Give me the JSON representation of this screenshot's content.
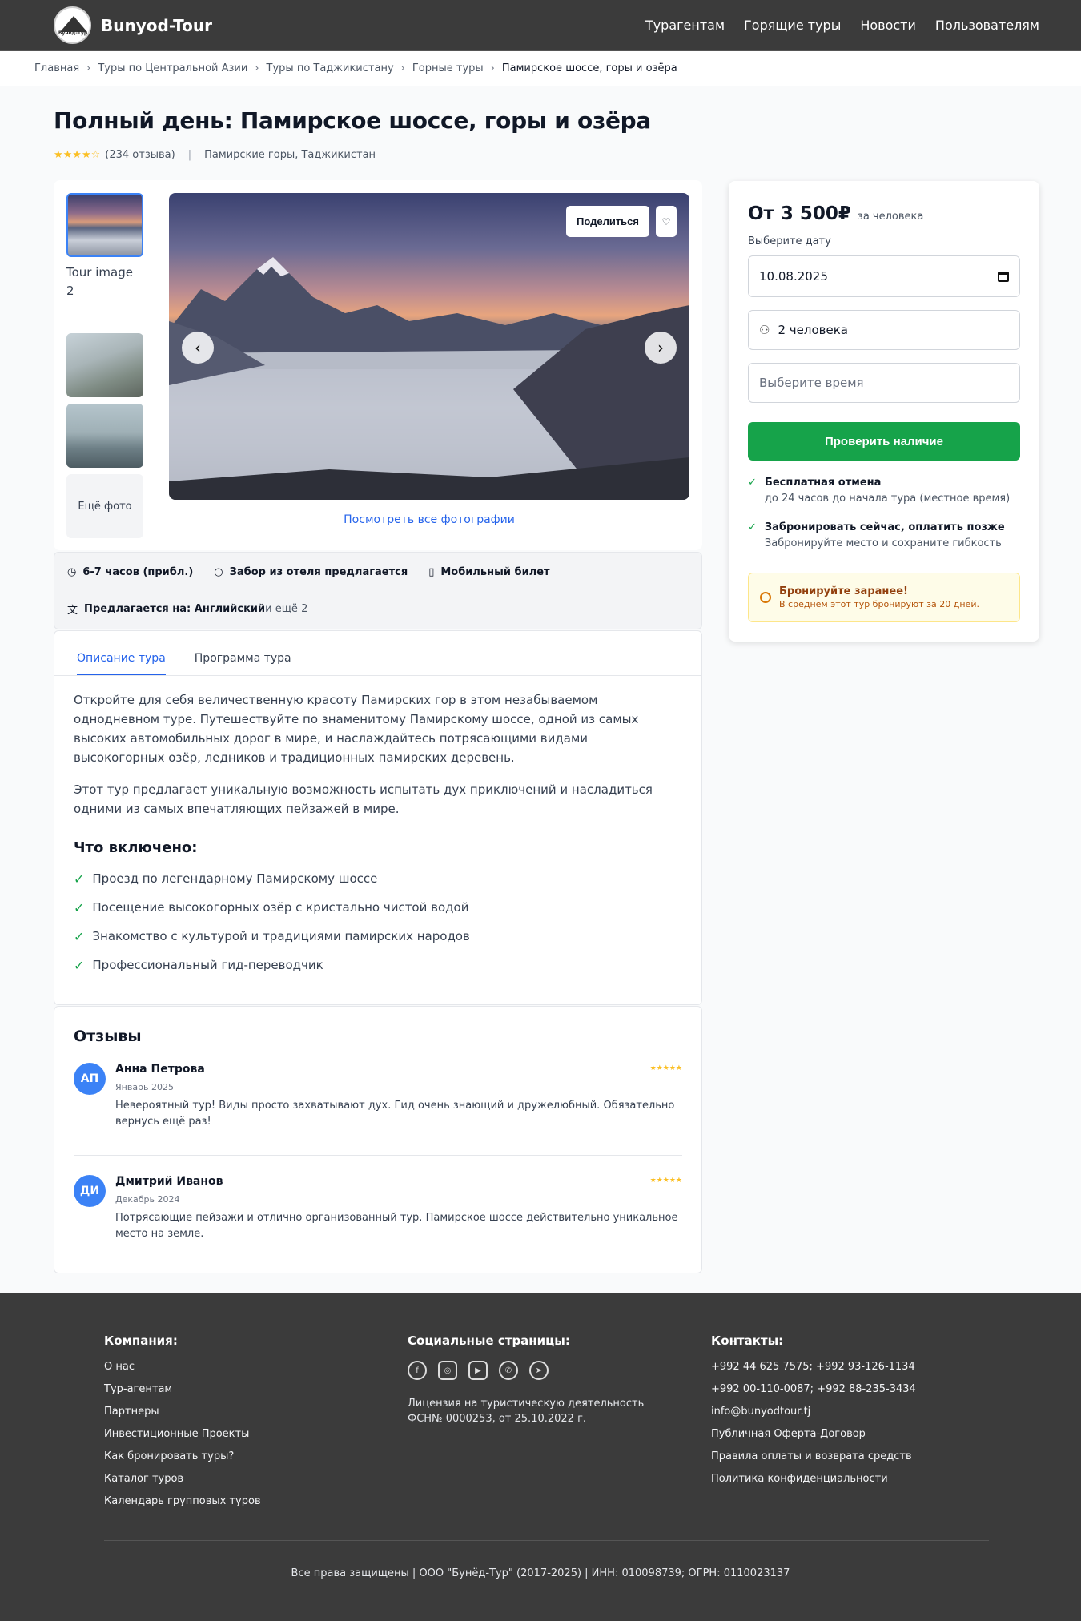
{
  "header": {
    "logo_text": "Bunyod-Tour",
    "logo_mark": "Бунёд-Тур",
    "nav": [
      "Турагентам",
      "Горящие туры",
      "Новости",
      "Пользователям"
    ]
  },
  "breadcrumb": [
    "Главная",
    "Туры по Центральной Азии",
    "Туры по Таджикистану",
    "Горные туры",
    "Памирское шоссе, горы и озёра"
  ],
  "tour": {
    "title": "Полный день: Памирское шоссе, горы и озёра",
    "rating_stars": "★★★★☆",
    "reviews_count": "(234 отзыва)",
    "location": "Памирские горы, Таджикистан"
  },
  "gallery": {
    "broken_alt": "Tour image 2",
    "more_photos": "Ещё фото",
    "share": "Поделиться",
    "view_all": "Посмотреть все фотографии"
  },
  "info": {
    "duration": "6-7 часов (прибл.)",
    "pickup": "Забор из отеля предлагается",
    "ticket": "Мобильный билет",
    "languages_label": "Предлагается на: Английский",
    "languages_more": " и ещё 2"
  },
  "tabs": [
    "Описание тура",
    "Программа тура"
  ],
  "description": {
    "p1": "Откройте для себя величественную красоту Памирских гор в этом незабываемом однодневном туре. Путешествуйте по знаменитому Памирскому шоссе, одной из самых высоких автомобильных дорог в мире, и наслаждайтесь потрясающими видами высокогорных озёр, ледников и традиционных памирских деревень.",
    "p2": "Этот тур предлагает уникальную возможность испытать дух приключений и насладиться одними из самых впечатляющих пейзажей в мире.",
    "included_title": "Что включено:",
    "included": [
      "Проезд по легендарному Памирскому шоссе",
      "Посещение высокогорных озёр с кристально чистой водой",
      "Знакомство с культурой и традициями памирских народов",
      "Профессиональный гид-переводчик"
    ]
  },
  "reviews": {
    "title": "Отзывы",
    "items": [
      {
        "initials": "АП",
        "name": "Анна Петрова",
        "date": "Январь 2025",
        "stars": "★★★★★",
        "text": "Невероятный тур! Виды просто захватывают дух. Гид очень знающий и дружелюбный. Обязательно вернусь ещё раз!"
      },
      {
        "initials": "ДИ",
        "name": "Дмитрий Иванов",
        "date": "Декабрь 2024",
        "stars": "★★★★★",
        "text": "Потрясающие пейзажи и отлично организованный тур. Памирское шоссе действительно уникальное место на земле."
      }
    ]
  },
  "booking": {
    "price": "От 3 500₽",
    "per_person": "за человека",
    "date_label": "Выберите дату",
    "date_value": "10.08.2025",
    "people": "2 человека",
    "time_placeholder": "Выберите время",
    "check_button": "Проверить наличие",
    "perk1_title": "Бесплатная отмена",
    "perk1_sub": "до 24 часов до начала тура (местное время)",
    "perk2_title": "Забронировать сейчас, оплатить позже",
    "perk2_sub": "Забронируйте место и сохраните гибкость",
    "notice_title": "Бронируйте заранее!",
    "notice_sub": "В среднем этот тур бронируют за 20 дней.",
    "accent_color": "#16a34a"
  },
  "footer": {
    "company_title": "Компания:",
    "company_links": [
      "О нас",
      "Тур-агентам",
      "Партнеры",
      "Инвестиционные Проекты",
      "Как бронировать туры?",
      "Каталог туров",
      "Календарь групповых туров"
    ],
    "social_title": "Социальные страницы:",
    "social_icons": [
      "facebook-icon",
      "instagram-icon",
      "youtube-icon",
      "whatsapp-icon",
      "telegram-icon"
    ],
    "license": "Лицензия на туристическую деятельность ФСН№ 0000253, от 25.10.2022 г.",
    "contacts_title": "Контакты:",
    "contacts": [
      "+992 44 625 7575; +992 93-126-1134",
      "+992 00-110-0087; +992 88-235-3434",
      "info@bunyodtour.tj",
      "Публичная Оферта-Договор",
      "Правила оплаты и возврата средств",
      "Политика конфиденциальности"
    ],
    "copyright": "Все права защищены | ООО \"Бунёд-Тур\" (2017-2025) | ИНН: 010098739; ОГРН: 0110023137"
  }
}
